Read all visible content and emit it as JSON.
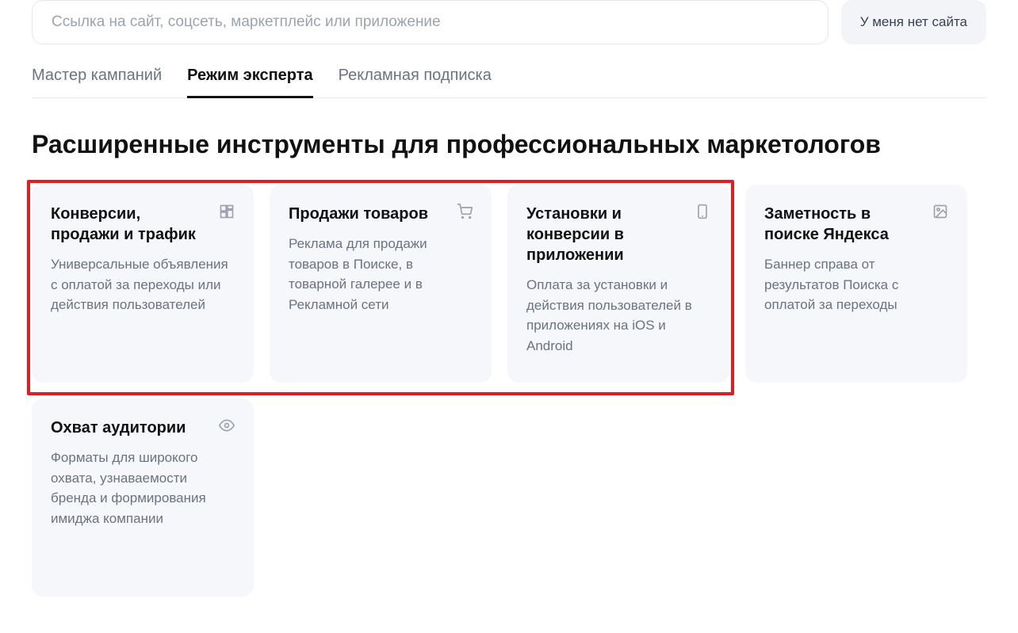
{
  "input": {
    "placeholder": "Ссылка на сайт, соцсеть, маркетплейс или приложение"
  },
  "no_site_btn": "У меня нет сайта",
  "tabs": [
    {
      "label": "Мастер кампаний",
      "active": false
    },
    {
      "label": "Режим эксперта",
      "active": true
    },
    {
      "label": "Рекламная подписка",
      "active": false
    }
  ],
  "title": "Расширенные инструменты для профессиональных маркетологов",
  "cards": [
    {
      "title": "Конверсии, продажи и трафик",
      "desc": "Универсальные объявления с оплатой за переходы или действия пользователей",
      "icon": "layout"
    },
    {
      "title": "Продажи товаров",
      "desc": "Реклама для продажи товаров в Поиске, в товарной галерее и в Рекламной сети",
      "icon": "cart"
    },
    {
      "title": "Установки и конверсии в приложении",
      "desc": "Оплата за установки и действия пользователей в приложениях на iOS и Android",
      "icon": "phone"
    },
    {
      "title": "Заметность в поиске Яндекса",
      "desc": "Баннер справа от результатов Поиска с оплатой за переходы",
      "icon": "image"
    },
    {
      "title": "Охват аудитории",
      "desc": "Форматы для широкого охвата, узнаваемости бренда и формирования имиджа компании",
      "icon": "eye"
    }
  ]
}
